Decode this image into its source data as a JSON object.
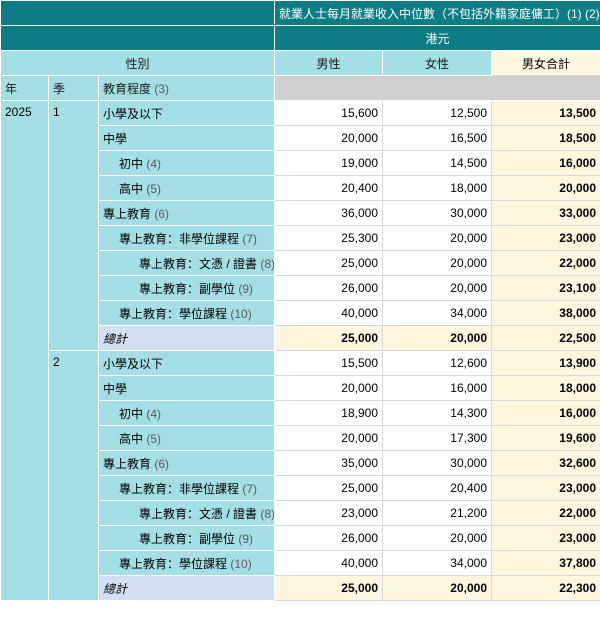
{
  "header": {
    "title": "就業人士每月就業收入中位數（不包括外籍家庭傭工）(1) (2)",
    "unit": "港元",
    "sex_label": "性別",
    "columns": [
      "男性",
      "女性",
      "男女合計"
    ],
    "year_label": "年",
    "quarter_label": "季",
    "education_label": "教育程度",
    "education_note": "(3)"
  },
  "year": "2025",
  "quarters": [
    {
      "quarter": "1",
      "rows": [
        {
          "label": "小學及以下",
          "note": "",
          "level": 0,
          "male": "15,600",
          "female": "12,500",
          "total": "13,500"
        },
        {
          "label": "中學",
          "note": "",
          "level": 0,
          "male": "20,000",
          "female": "16,500",
          "total": "18,500"
        },
        {
          "label": "初中",
          "note": "(4)",
          "level": 1,
          "male": "19,000",
          "female": "14,500",
          "total": "16,000"
        },
        {
          "label": "高中",
          "note": "(5)",
          "level": 1,
          "male": "20,400",
          "female": "18,000",
          "total": "20,000"
        },
        {
          "label": "專上教育",
          "note": "(6)",
          "level": 0,
          "male": "36,000",
          "female": "30,000",
          "total": "33,000"
        },
        {
          "label": "專上教育：非學位課程",
          "note": "(7)",
          "level": 1,
          "male": "25,300",
          "female": "20,000",
          "total": "23,000"
        },
        {
          "label": "專上教育：文憑 / 證書",
          "note": "(8)",
          "level": 2,
          "male": "25,000",
          "female": "20,000",
          "total": "22,000"
        },
        {
          "label": "專上教育：副學位",
          "note": "(9)",
          "level": 2,
          "male": "26,000",
          "female": "20,000",
          "total": "23,100"
        },
        {
          "label": "專上教育：學位課程",
          "note": "(10)",
          "level": 1,
          "male": "40,000",
          "female": "34,000",
          "total": "38,000"
        }
      ],
      "total": {
        "label": "總計",
        "male": "25,000",
        "female": "20,000",
        "total": "22,500"
      }
    },
    {
      "quarter": "2",
      "rows": [
        {
          "label": "小學及以下",
          "note": "",
          "level": 0,
          "male": "15,500",
          "female": "12,600",
          "total": "13,900"
        },
        {
          "label": "中學",
          "note": "",
          "level": 0,
          "male": "20,000",
          "female": "16,000",
          "total": "18,000"
        },
        {
          "label": "初中",
          "note": "(4)",
          "level": 1,
          "male": "18,900",
          "female": "14,300",
          "total": "16,000"
        },
        {
          "label": "高中",
          "note": "(5)",
          "level": 1,
          "male": "20,000",
          "female": "17,300",
          "total": "19,600"
        },
        {
          "label": "專上教育",
          "note": "(6)",
          "level": 0,
          "male": "35,000",
          "female": "30,000",
          "total": "32,600"
        },
        {
          "label": "專上教育：非學位課程",
          "note": "(7)",
          "level": 1,
          "male": "25,000",
          "female": "20,400",
          "total": "23,000"
        },
        {
          "label": "專上教育：文憑 / 證書",
          "note": "(8)",
          "level": 2,
          "male": "23,000",
          "female": "21,200",
          "total": "22,000"
        },
        {
          "label": "專上教育：副學位",
          "note": "(9)",
          "level": 2,
          "male": "26,000",
          "female": "20,000",
          "total": "23,000"
        },
        {
          "label": "專上教育：學位課程",
          "note": "(10)",
          "level": 1,
          "male": "40,000",
          "female": "34,000",
          "total": "37,800"
        }
      ],
      "total": {
        "label": "總計",
        "male": "25,000",
        "female": "20,000",
        "total": "22,300"
      }
    }
  ]
}
